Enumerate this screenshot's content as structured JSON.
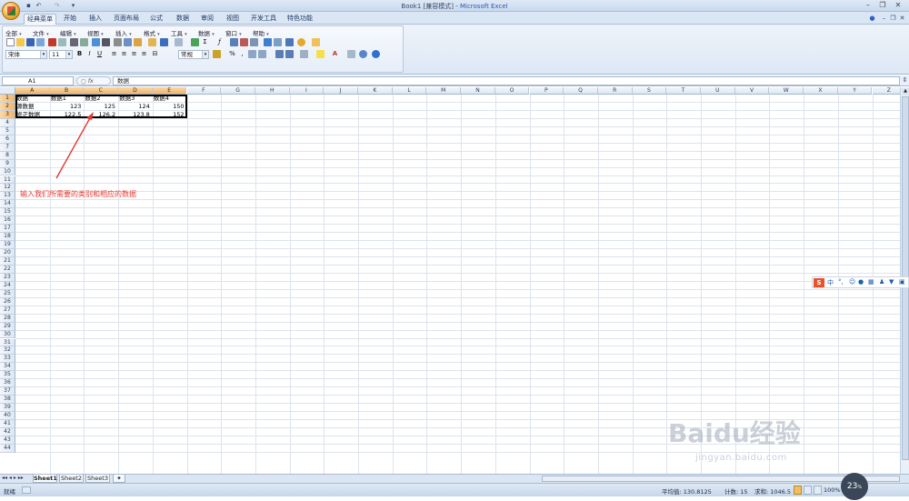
{
  "window": {
    "doc_title": "Book1 [兼容模式] - ",
    "app_name": "Microsoft Excel",
    "quick_access": [
      "save-icon",
      "undo-icon",
      "redo-icon"
    ]
  },
  "ribbon": {
    "tabs": [
      "经典菜单",
      "开始",
      "插入",
      "页面布局",
      "公式",
      "数据",
      "审阅",
      "视图",
      "开发工具",
      "特色功能"
    ],
    "active_tab": "经典菜单",
    "menus": [
      "全部",
      "文件",
      "编辑",
      "视图",
      "插入",
      "格式",
      "工具",
      "数据",
      "窗口",
      "帮助"
    ],
    "font_name": "宋体",
    "font_size": "11",
    "number_format": "常规",
    "format_buttons": [
      "B",
      "I",
      "U"
    ]
  },
  "formula_bar": {
    "name_box": "A1",
    "fx_label": "fx",
    "content": "数据"
  },
  "grid": {
    "columns": [
      "A",
      "B",
      "C",
      "D",
      "E",
      "F",
      "G",
      "H",
      "I",
      "J",
      "K",
      "L",
      "M",
      "N",
      "O",
      "P",
      "Q",
      "R",
      "S",
      "T",
      "U",
      "V",
      "W",
      "X",
      "Y",
      "Z"
    ],
    "rows": [
      "1",
      "2",
      "3",
      "4",
      "5",
      "6",
      "7",
      "8",
      "9",
      "10",
      "11",
      "12",
      "13",
      "14",
      "15",
      "16",
      "17",
      "18",
      "19",
      "20",
      "21",
      "22",
      "23",
      "24",
      "25",
      "26",
      "27",
      "28",
      "29",
      "30",
      "31",
      "32",
      "33",
      "34",
      "35",
      "36",
      "37",
      "38",
      "39",
      "40",
      "41",
      "42",
      "43",
      "44"
    ],
    "data": [
      [
        "数据",
        "数据1",
        "数据2",
        "数据3",
        "数据4"
      ],
      [
        "源数据",
        "123",
        "125",
        "124",
        "150"
      ],
      [
        "修正数据",
        "122.5",
        "126.2",
        "123.8",
        "152"
      ]
    ]
  },
  "annotation": "输入我们所需要的类别和相应的数据",
  "sheets": [
    "Sheet1",
    "Sheet2",
    "Sheet3"
  ],
  "active_sheet": "Sheet1",
  "status": {
    "mode": "就绪",
    "average": "平均值: 130.8125",
    "count": "计数: 15",
    "sum": "求和: 1046.5",
    "zoom": "100%"
  },
  "overlay": {
    "badge": "23",
    "badge_unit": "%",
    "watermark": "Baidu经验",
    "watermark_url": "jingyan.baidu.com",
    "ime_logo": "S",
    "ime_mode": "中"
  },
  "colors": {
    "selected_header": "#f1b46a",
    "annotation": "#e53935",
    "ribbon_bg": "#dde8f5"
  }
}
